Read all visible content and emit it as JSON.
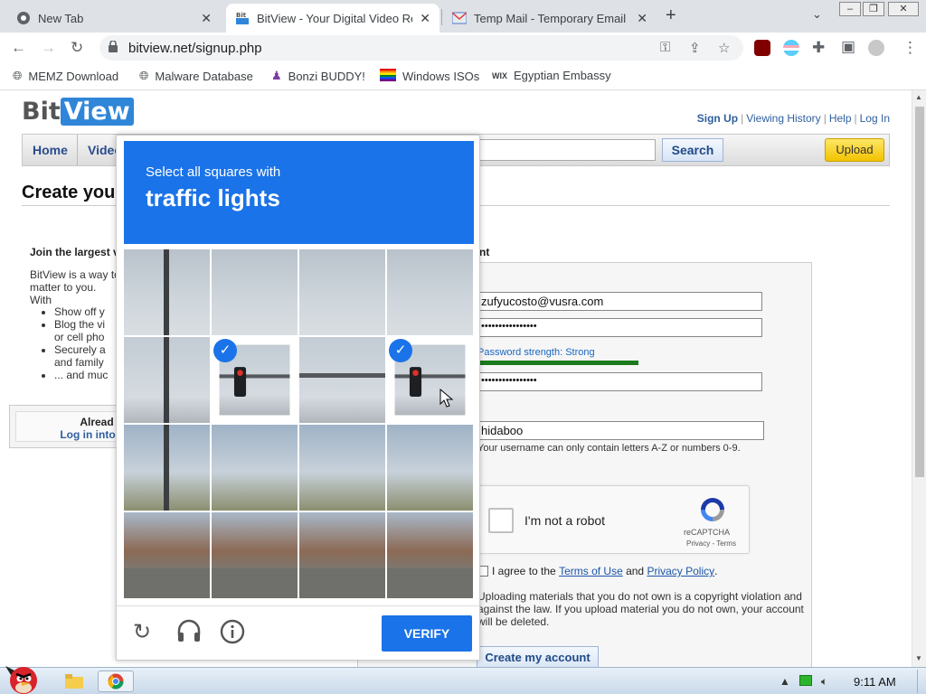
{
  "browser": {
    "tabs": [
      {
        "title": "New Tab",
        "active": false
      },
      {
        "title": "BitView - Your Digital Video Re",
        "active": true
      },
      {
        "title": "Temp Mail - Temporary Email",
        "active": false
      }
    ],
    "url": "bitview.net/signup.php",
    "bookmarks": [
      {
        "label": "MEMZ Download",
        "icon": "globe-icon"
      },
      {
        "label": "Malware Database",
        "icon": "globe-icon"
      },
      {
        "label": "Bonzi BUDDY!",
        "icon": "bonzi-icon"
      },
      {
        "label": "Windows ISOs",
        "icon": "rainbow-flag-icon"
      },
      {
        "label": "Egyptian Embassy",
        "icon": "wix-icon"
      }
    ]
  },
  "site": {
    "logo_bit": "Bit",
    "logo_view": "View",
    "toplinks": {
      "signup": "Sign Up",
      "history": "Viewing History",
      "help": "Help",
      "login": "Log In"
    },
    "nav": {
      "home": "Home",
      "videos": "Video"
    },
    "search_button": "Search",
    "upload_button": "Upload",
    "page_title": "Create you",
    "left": {
      "heading": "Join the largest v",
      "desc": "BitView is a way to ... matter to you. With",
      "desc_line1": "BitView is a way to",
      "desc_line2": "matter to you. With",
      "bullets": [
        "Show off y",
        "Blog the vi",
        "or cell pho",
        "Securely a",
        "and family",
        "... and muc"
      ],
      "already": "Alread",
      "login_into": "Log in into"
    },
    "form": {
      "heading": "nt",
      "email": "zufyucosto@vusra.com",
      "password_mask": "••••••••••••••••",
      "password_strength": "Password strength: Strong",
      "password_strength_fraction": 0.55,
      "confirm_mask": "••••••••••••••••",
      "username": "hidaboo",
      "username_hint": "Your username can only contain letters A-Z or numbers 0-9.",
      "recaptcha": {
        "label": "I'm not a robot",
        "brand": "reCAPTCHA",
        "terms": "Privacy - Terms"
      },
      "agree_prefix": "I agree to the ",
      "terms_link": "Terms of Use",
      "agree_and": " and ",
      "privacy_link": "Privacy Policy",
      "agree_suffix": ".",
      "legal": "Uploading materials that you do not own is a copyright violation and against the law. If you upload material you do not own, your account will be deleted.",
      "create_button": "Create my account"
    }
  },
  "challenge": {
    "instruction": "Select all squares with",
    "target": "traffic lights",
    "selected_tiles": [
      5,
      7
    ],
    "verify_button": "VERIFY",
    "accent": "#1a73e8"
  },
  "taskbar": {
    "clock": "9:11 AM"
  }
}
